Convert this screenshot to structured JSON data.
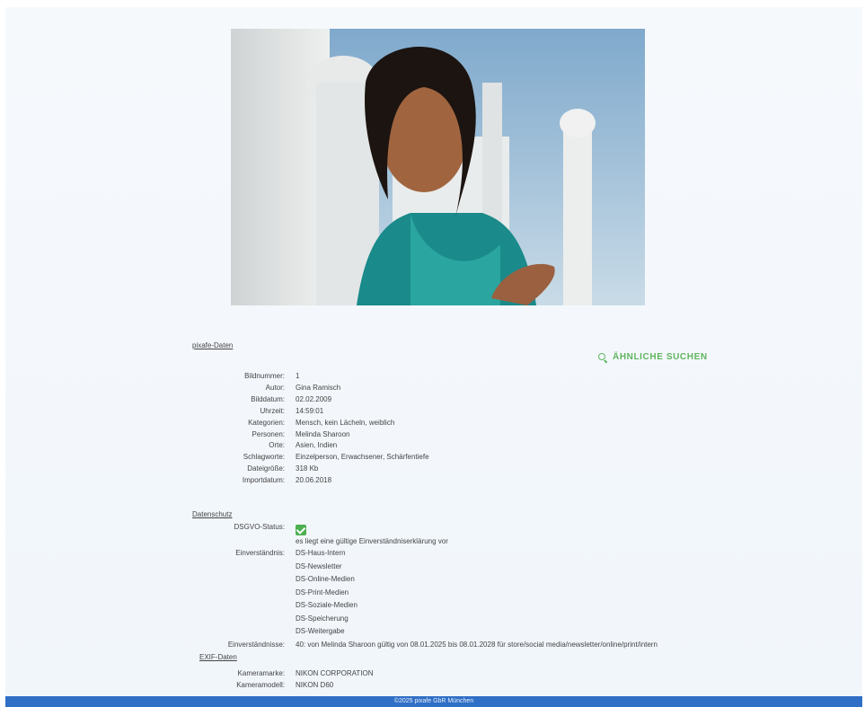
{
  "pixafe_section": "pixafe-Daten",
  "similar_button": "ÄHNLICHE SUCHEN",
  "pixafe_fields": [
    {
      "label": "Bildnummer:",
      "value": "1"
    },
    {
      "label": "Autor:",
      "value": "Gina Ramisch"
    },
    {
      "label": "Bilddatum:",
      "value": "02.02.2009"
    },
    {
      "label": "Uhrzeit:",
      "value": "14:59:01"
    },
    {
      "label": "Kategorien:",
      "value": "Mensch, kein Lächeln, weiblich"
    },
    {
      "label": "Personen:",
      "value": "Melinda Sharoon"
    },
    {
      "label": "Orte:",
      "value": "Asien, Indien"
    },
    {
      "label": "Schlagworte:",
      "value": "Einzelperson, Erwachsener, Schärfentiefe"
    },
    {
      "label": "Dateigröße:",
      "value": "318 Kb"
    },
    {
      "label": "Importdatum:",
      "value": "20.06.2018"
    }
  ],
  "datenschutz_section": "Datenschutz",
  "dsgvo_label": "DSGVO-Status:",
  "dsgvo_status": "checked",
  "einverstaendnis_note": "es liegt eine gültige Einverständniserklärung vor",
  "einverstaendnis_label": "Einverständnis:",
  "einverstaendnis_items": [
    "DS-Haus-Intern",
    "DS-Newsletter",
    "DS-Online-Medien",
    "DS-Print-Medien",
    "DS-Soziale-Medien",
    "DS-Speicherung",
    "DS-Weitergabe"
  ],
  "einverstaendnisse_label": "Einverständnisse:",
  "einverstaendnisse_value": "40: von Melinda Sharoon gültig von 08.01.2025 bis 08.01.2028 für store/social media/newsletter/online/print/intern",
  "exif_section": "EXIF-Daten",
  "exif_fields": [
    {
      "label": "Kameramarke:",
      "value": "NIKON CORPORATION"
    },
    {
      "label": "Kameramodell:",
      "value": "NIKON D60"
    }
  ],
  "footer": "©2025 pixafe GbR München",
  "colors": {
    "accent": "#5fb55f",
    "footer": "#2f6fc6",
    "check": "#4cb050"
  }
}
